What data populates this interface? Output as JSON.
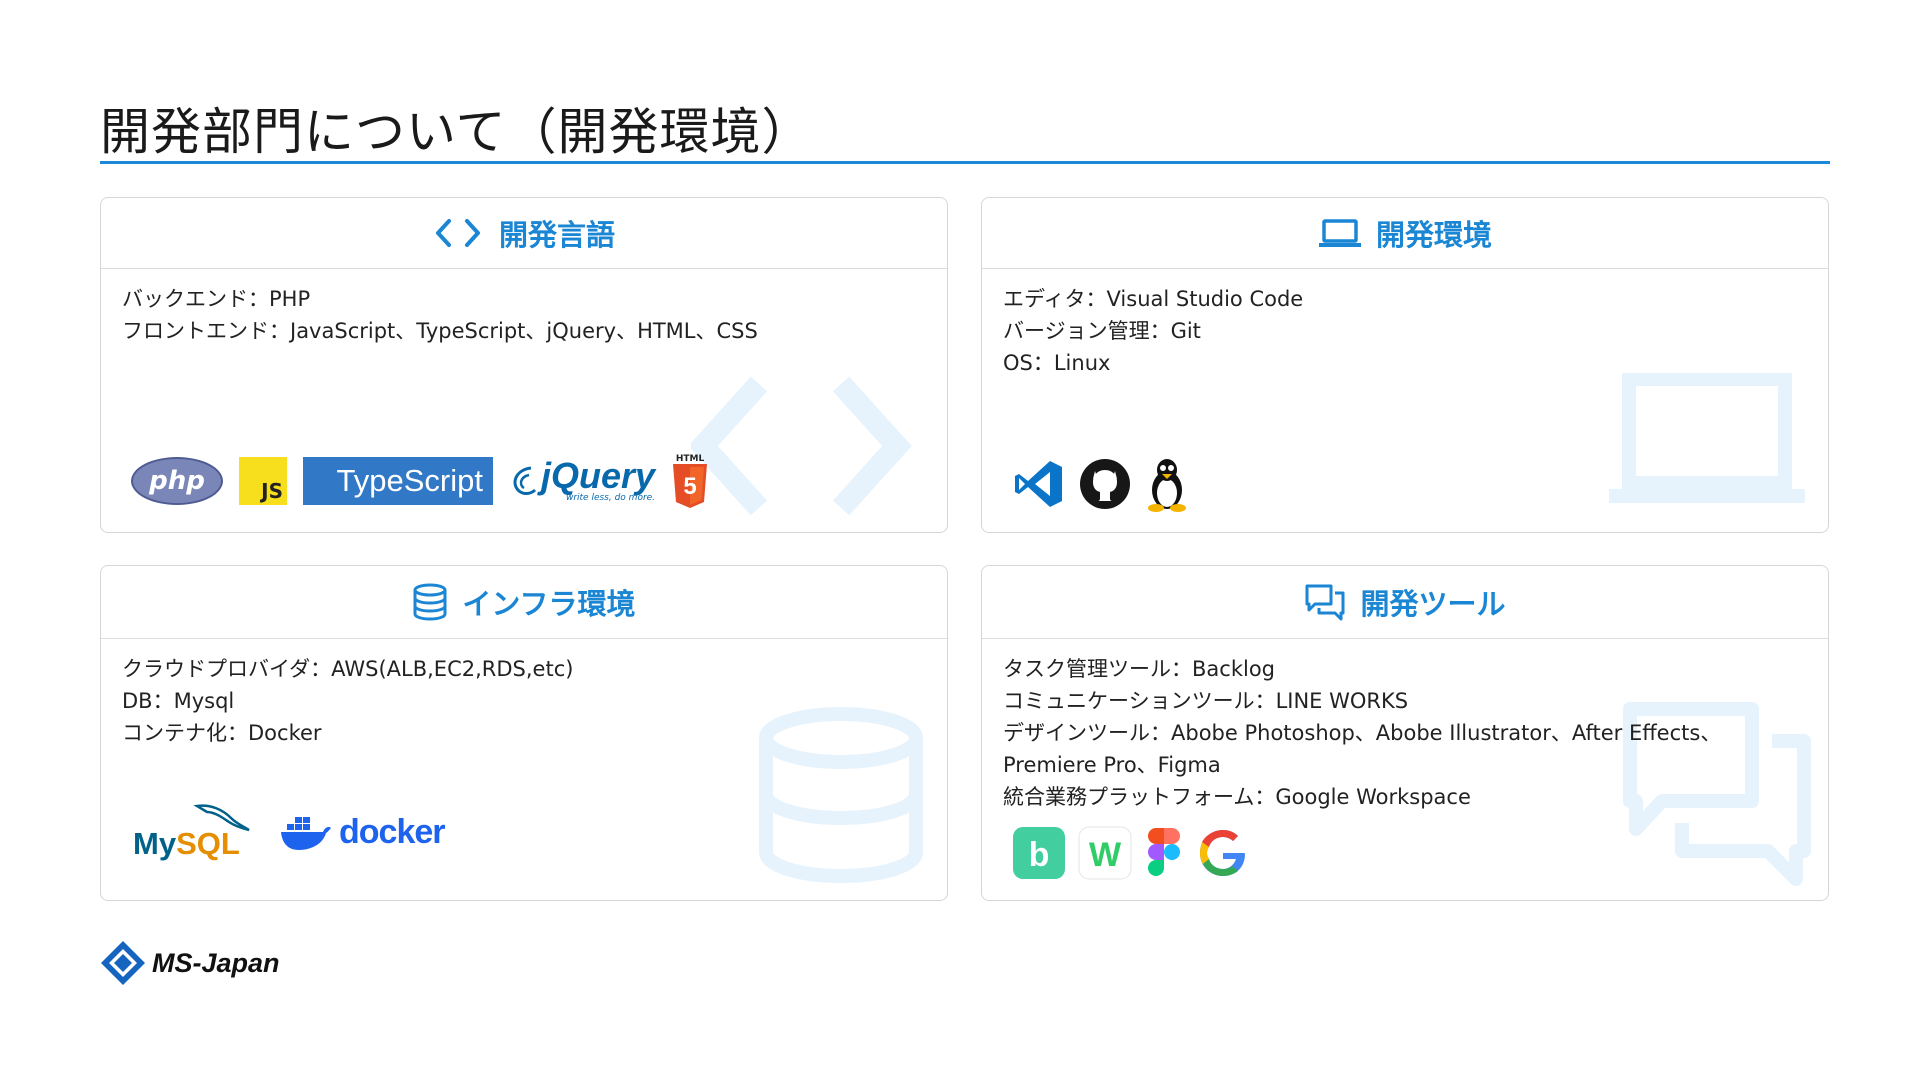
{
  "page": {
    "title": "開発部門について（開発環境）"
  },
  "cards": {
    "languages": {
      "heading": "開発言語",
      "lines": [
        "バックエンド：PHP",
        "フロントエンド：JavaScript、TypeScript、jQuery、HTML、CSS"
      ],
      "logos": {
        "php": "php",
        "js": "JS",
        "typescript": "TypeScript",
        "jquery": "jQuery",
        "jquery_tagline": "write less, do more.",
        "html": "HTML",
        "html_number": "5"
      }
    },
    "environment": {
      "heading": "開発環境",
      "lines": [
        "エディタ：Visual Studio Code",
        "バージョン管理：Git",
        "OS：Linux"
      ]
    },
    "infra": {
      "heading": "インフラ環境",
      "lines": [
        "クラウドプロバイダ：AWS(ALB,EC2,RDS,etc)",
        "DB：Mysql",
        "コンテナ化：Docker"
      ],
      "logos": {
        "mysql_a": "My",
        "mysql_b": "SQL",
        "docker": "docker"
      }
    },
    "tools": {
      "heading": "開発ツール",
      "lines": [
        "タスク管理ツール：Backlog",
        "コミュニケーションツール：LINE WORKS",
        "デザインツール：Abobe Photoshop、Abobe Illustrator、After Effects、",
        "Premiere Pro、Figma",
        "統合業務プラットフォーム：Google Workspace"
      ],
      "logos": {
        "backlog": "b",
        "lineworks": "W",
        "google": "G"
      }
    }
  },
  "footer": {
    "company": "MS-Japan"
  },
  "colors": {
    "accent": "#1e88d8",
    "heading": "#1a86d4",
    "watermark": "#e6f3fc"
  }
}
